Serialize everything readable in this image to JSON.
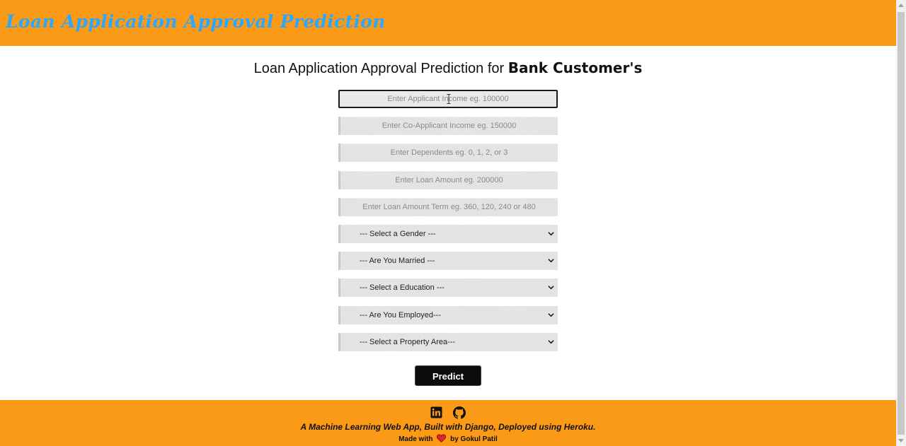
{
  "header": {
    "brand": "Loan Application Approval Prediction"
  },
  "main": {
    "headline_prefix": "Loan Application Approval Prediction for ",
    "headline_bold": "Bank Customer's"
  },
  "form": {
    "inputs": [
      {
        "placeholder": "Enter Applicant Income eg. 100000",
        "value": ""
      },
      {
        "placeholder": "Enter Co-Applicant Income eg. 150000",
        "value": ""
      },
      {
        "placeholder": "Enter Dependents eg. 0, 1, 2, or 3",
        "value": ""
      },
      {
        "placeholder": "Enter Loan Amount eg. 200000",
        "value": ""
      },
      {
        "placeholder": "Enter Loan Amount Term eg. 360, 120, 240 or 480",
        "value": ""
      }
    ],
    "selects": [
      {
        "selected": "--- Select a Gender ---"
      },
      {
        "selected": "--- Are You Married ---"
      },
      {
        "selected": "--- Select a Education ---"
      },
      {
        "selected": "--- Are You Employed---"
      },
      {
        "selected": "--- Select a Property Area---"
      }
    ],
    "predict_label": "Predict"
  },
  "footer": {
    "icons": [
      "linkedin-icon",
      "github-icon"
    ],
    "tagline": "A Machine Learning Web App, Built with Django, Deployed using Heroku.",
    "made_with": "Made with",
    "by": "by Gokul Patil"
  },
  "colors": {
    "brand_bar": "#fb9a17",
    "brand_text": "#2aa7ff",
    "button": "#0c0c0c",
    "heart": "#e0242c"
  }
}
